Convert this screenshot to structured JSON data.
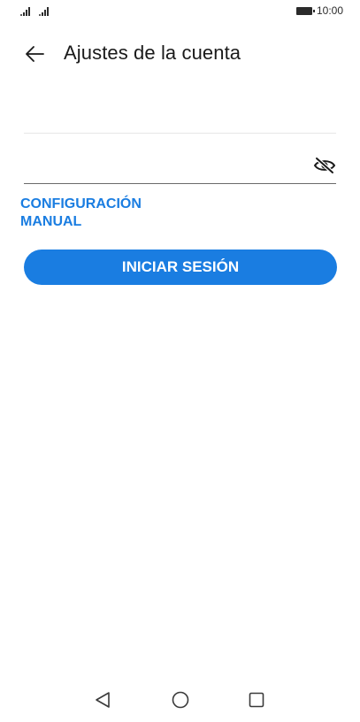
{
  "status_bar": {
    "time": "10:00",
    "signal_icon": "signal-icon",
    "battery_icon": "battery-icon"
  },
  "header": {
    "title": "Ajustes de la cuenta",
    "back_icon": "arrow-left-icon"
  },
  "form": {
    "email": {
      "value": "",
      "placeholder": ""
    },
    "password": {
      "value": "",
      "placeholder": "",
      "toggle_icon": "eye-off-icon"
    },
    "manual_config_label": "CONFIGURACIÓN MANUAL",
    "login_label": "INICIAR SESIÓN"
  },
  "colors": {
    "accent": "#1a7de1",
    "text": "#1a1a1a",
    "divider": "#e6e6e6"
  },
  "nav_bar": {
    "back_icon": "triangle-back-icon",
    "home_icon": "circle-home-icon",
    "recent_icon": "square-recent-icon"
  }
}
